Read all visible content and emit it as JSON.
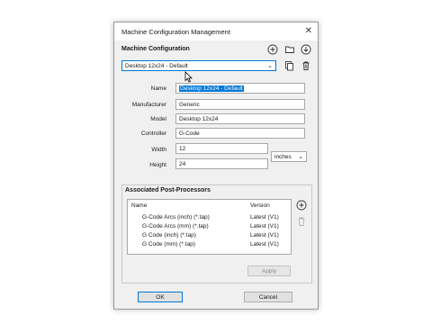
{
  "window": {
    "title": "Machine Configuration Management"
  },
  "machine_configuration": {
    "section_title": "Machine Configuration",
    "selected": "Desktop 12x24 - Default",
    "icons": [
      "add-icon",
      "open-folder-icon",
      "import-icon",
      "copy-icon",
      "delete-icon"
    ]
  },
  "form": {
    "name_label": "Name",
    "name_value": "Desktop 12x24 - Default",
    "manufacturer_label": "Manufacturer",
    "manufacturer_value": "Generic",
    "model_label": "Model",
    "model_value": "Desktop 12x24",
    "controller_label": "Controller",
    "controller_value": "G-Code",
    "width_label": "Width",
    "width_value": "12",
    "height_label": "Height",
    "height_value": "24",
    "units_value": "inches"
  },
  "post_processors": {
    "section_title": "Associated Post-Processors",
    "columns": [
      "Name",
      "Version"
    ],
    "rows": [
      {
        "name": "G-Code Arcs (inch) (*.tap)",
        "version": "Latest (V1)"
      },
      {
        "name": "G-Code Arcs (mm) (*.tap)",
        "version": "Latest (V1)"
      },
      {
        "name": "G Code (inch) (*.tap)",
        "version": "Latest (V1)"
      },
      {
        "name": "G Code (mm) (*.tap)",
        "version": "Latest (V1)"
      }
    ],
    "apply_label": "Apply"
  },
  "footer": {
    "ok_label": "OK",
    "cancel_label": "Cancel"
  }
}
